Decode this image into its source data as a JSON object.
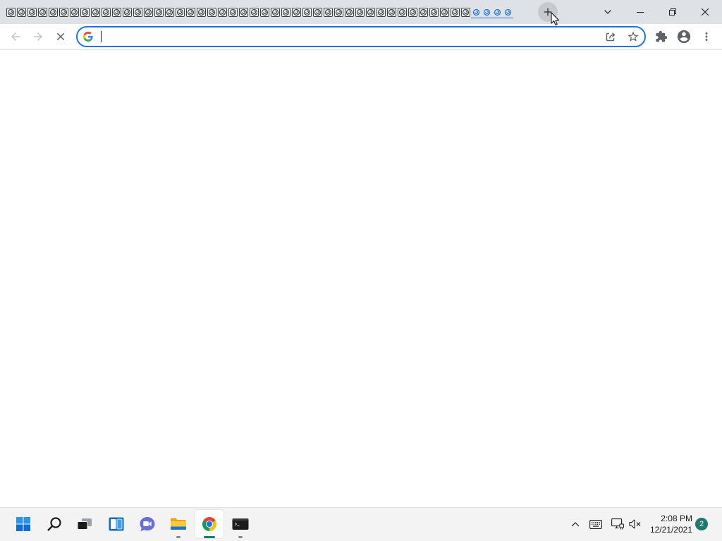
{
  "colors": {
    "tabstrip_bg": "#dee1e6",
    "toolbar_bg": "#ffffff",
    "omnibox_border": "#1a73e8",
    "highlight_tab": "#1a73e8",
    "new_tab_hover": "#c6c9ce",
    "taskbar_bg": "#f3f3f3",
    "accent": "#1f7a6e"
  },
  "tabstrip": {
    "tabs": [
      {
        "icon": "loading-throbber-icon",
        "highlighted": false
      },
      {
        "icon": "loading-throbber-icon",
        "highlighted": false
      },
      {
        "icon": "loading-throbber-icon",
        "highlighted": false
      },
      {
        "icon": "loading-throbber-icon",
        "highlighted": false
      },
      {
        "icon": "loading-throbber-icon",
        "highlighted": false
      },
      {
        "icon": "loading-throbber-icon",
        "highlighted": false
      },
      {
        "icon": "loading-throbber-icon",
        "highlighted": false
      },
      {
        "icon": "loading-throbber-icon",
        "highlighted": false
      },
      {
        "icon": "loading-throbber-icon",
        "highlighted": false
      },
      {
        "icon": "loading-throbber-icon",
        "highlighted": false
      },
      {
        "icon": "loading-throbber-icon",
        "highlighted": false
      },
      {
        "icon": "loading-throbber-icon",
        "highlighted": false
      },
      {
        "icon": "loading-throbber-icon",
        "highlighted": false
      },
      {
        "icon": "loading-throbber-icon",
        "highlighted": false
      },
      {
        "icon": "loading-throbber-icon",
        "highlighted": false
      },
      {
        "icon": "loading-throbber-icon",
        "highlighted": false
      },
      {
        "icon": "loading-throbber-icon",
        "highlighted": false
      },
      {
        "icon": "loading-throbber-icon",
        "highlighted": false
      },
      {
        "icon": "loading-throbber-icon",
        "highlighted": false
      },
      {
        "icon": "loading-throbber-icon",
        "highlighted": false
      },
      {
        "icon": "loading-throbber-icon",
        "highlighted": false
      },
      {
        "icon": "loading-throbber-icon",
        "highlighted": false
      },
      {
        "icon": "loading-throbber-icon",
        "highlighted": false
      },
      {
        "icon": "loading-throbber-icon",
        "highlighted": false
      },
      {
        "icon": "loading-throbber-icon",
        "highlighted": false
      },
      {
        "icon": "loading-throbber-icon",
        "highlighted": false
      },
      {
        "icon": "loading-throbber-icon",
        "highlighted": false
      },
      {
        "icon": "loading-throbber-icon",
        "highlighted": false
      },
      {
        "icon": "loading-throbber-icon",
        "highlighted": false
      },
      {
        "icon": "loading-throbber-icon",
        "highlighted": false
      },
      {
        "icon": "loading-throbber-icon",
        "highlighted": false
      },
      {
        "icon": "loading-throbber-icon",
        "highlighted": false
      },
      {
        "icon": "loading-throbber-icon",
        "highlighted": false
      },
      {
        "icon": "loading-throbber-icon",
        "highlighted": false
      },
      {
        "icon": "loading-throbber-icon",
        "highlighted": false
      },
      {
        "icon": "loading-throbber-icon",
        "highlighted": false
      },
      {
        "icon": "loading-throbber-icon",
        "highlighted": false
      },
      {
        "icon": "loading-throbber-icon",
        "highlighted": false
      },
      {
        "icon": "loading-throbber-icon",
        "highlighted": false
      },
      {
        "icon": "loading-throbber-icon",
        "highlighted": false
      },
      {
        "icon": "loading-throbber-icon",
        "highlighted": false
      },
      {
        "icon": "loading-throbber-icon",
        "highlighted": false
      },
      {
        "icon": "loading-throbber-icon",
        "highlighted": false
      },
      {
        "icon": "loading-throbber-icon",
        "highlighted": false
      },
      {
        "icon": "loading-throbber-icon",
        "highlighted": true
      },
      {
        "icon": "loading-throbber-icon",
        "highlighted": true
      },
      {
        "icon": "loading-throbber-icon",
        "highlighted": true
      },
      {
        "icon": "loading-throbber-icon",
        "highlighted": true
      }
    ],
    "new_tab_icon": "plus-icon",
    "tab_search_icon": "chevron-down-icon",
    "minimize_icon": "minimize-icon",
    "restore_icon": "restore-icon",
    "close_icon": "close-icon"
  },
  "toolbar": {
    "back_icon": "arrow-left-icon",
    "back_enabled": false,
    "forward_icon": "arrow-right-icon",
    "forward_enabled": false,
    "stop_icon": "stop-loading-icon",
    "omnibox": {
      "value": "",
      "search_engine_icon": "google-g-icon",
      "share_icon": "share-icon",
      "bookmark_icon": "star-outline-icon"
    },
    "extensions_icon": "puzzle-piece-icon",
    "profile_icon": "account-circle-icon",
    "menu_icon": "kebab-menu-icon"
  },
  "taskbar": {
    "apps": [
      {
        "icon": "windows-start-icon",
        "running": false,
        "active": false
      },
      {
        "icon": "search-icon",
        "running": false,
        "active": false
      },
      {
        "icon": "task-view-icon",
        "running": false,
        "active": false
      },
      {
        "icon": "widgets-icon",
        "running": false,
        "active": false
      },
      {
        "icon": "teams-chat-icon",
        "running": false,
        "active": false
      },
      {
        "icon": "file-explorer-icon",
        "running": true,
        "active": false
      },
      {
        "icon": "chrome-icon",
        "running": true,
        "active": true
      },
      {
        "icon": "terminal-icon",
        "running": true,
        "active": false
      }
    ],
    "tray": {
      "overflow_icon": "chevron-up-icon",
      "input_icon": "keyboard-icon",
      "network_icon": "ethernet-icon",
      "volume_icon": "volume-muted-icon"
    },
    "clock": {
      "time": "2:08 PM",
      "date": "12/21/2021"
    },
    "notification_count": "2"
  }
}
